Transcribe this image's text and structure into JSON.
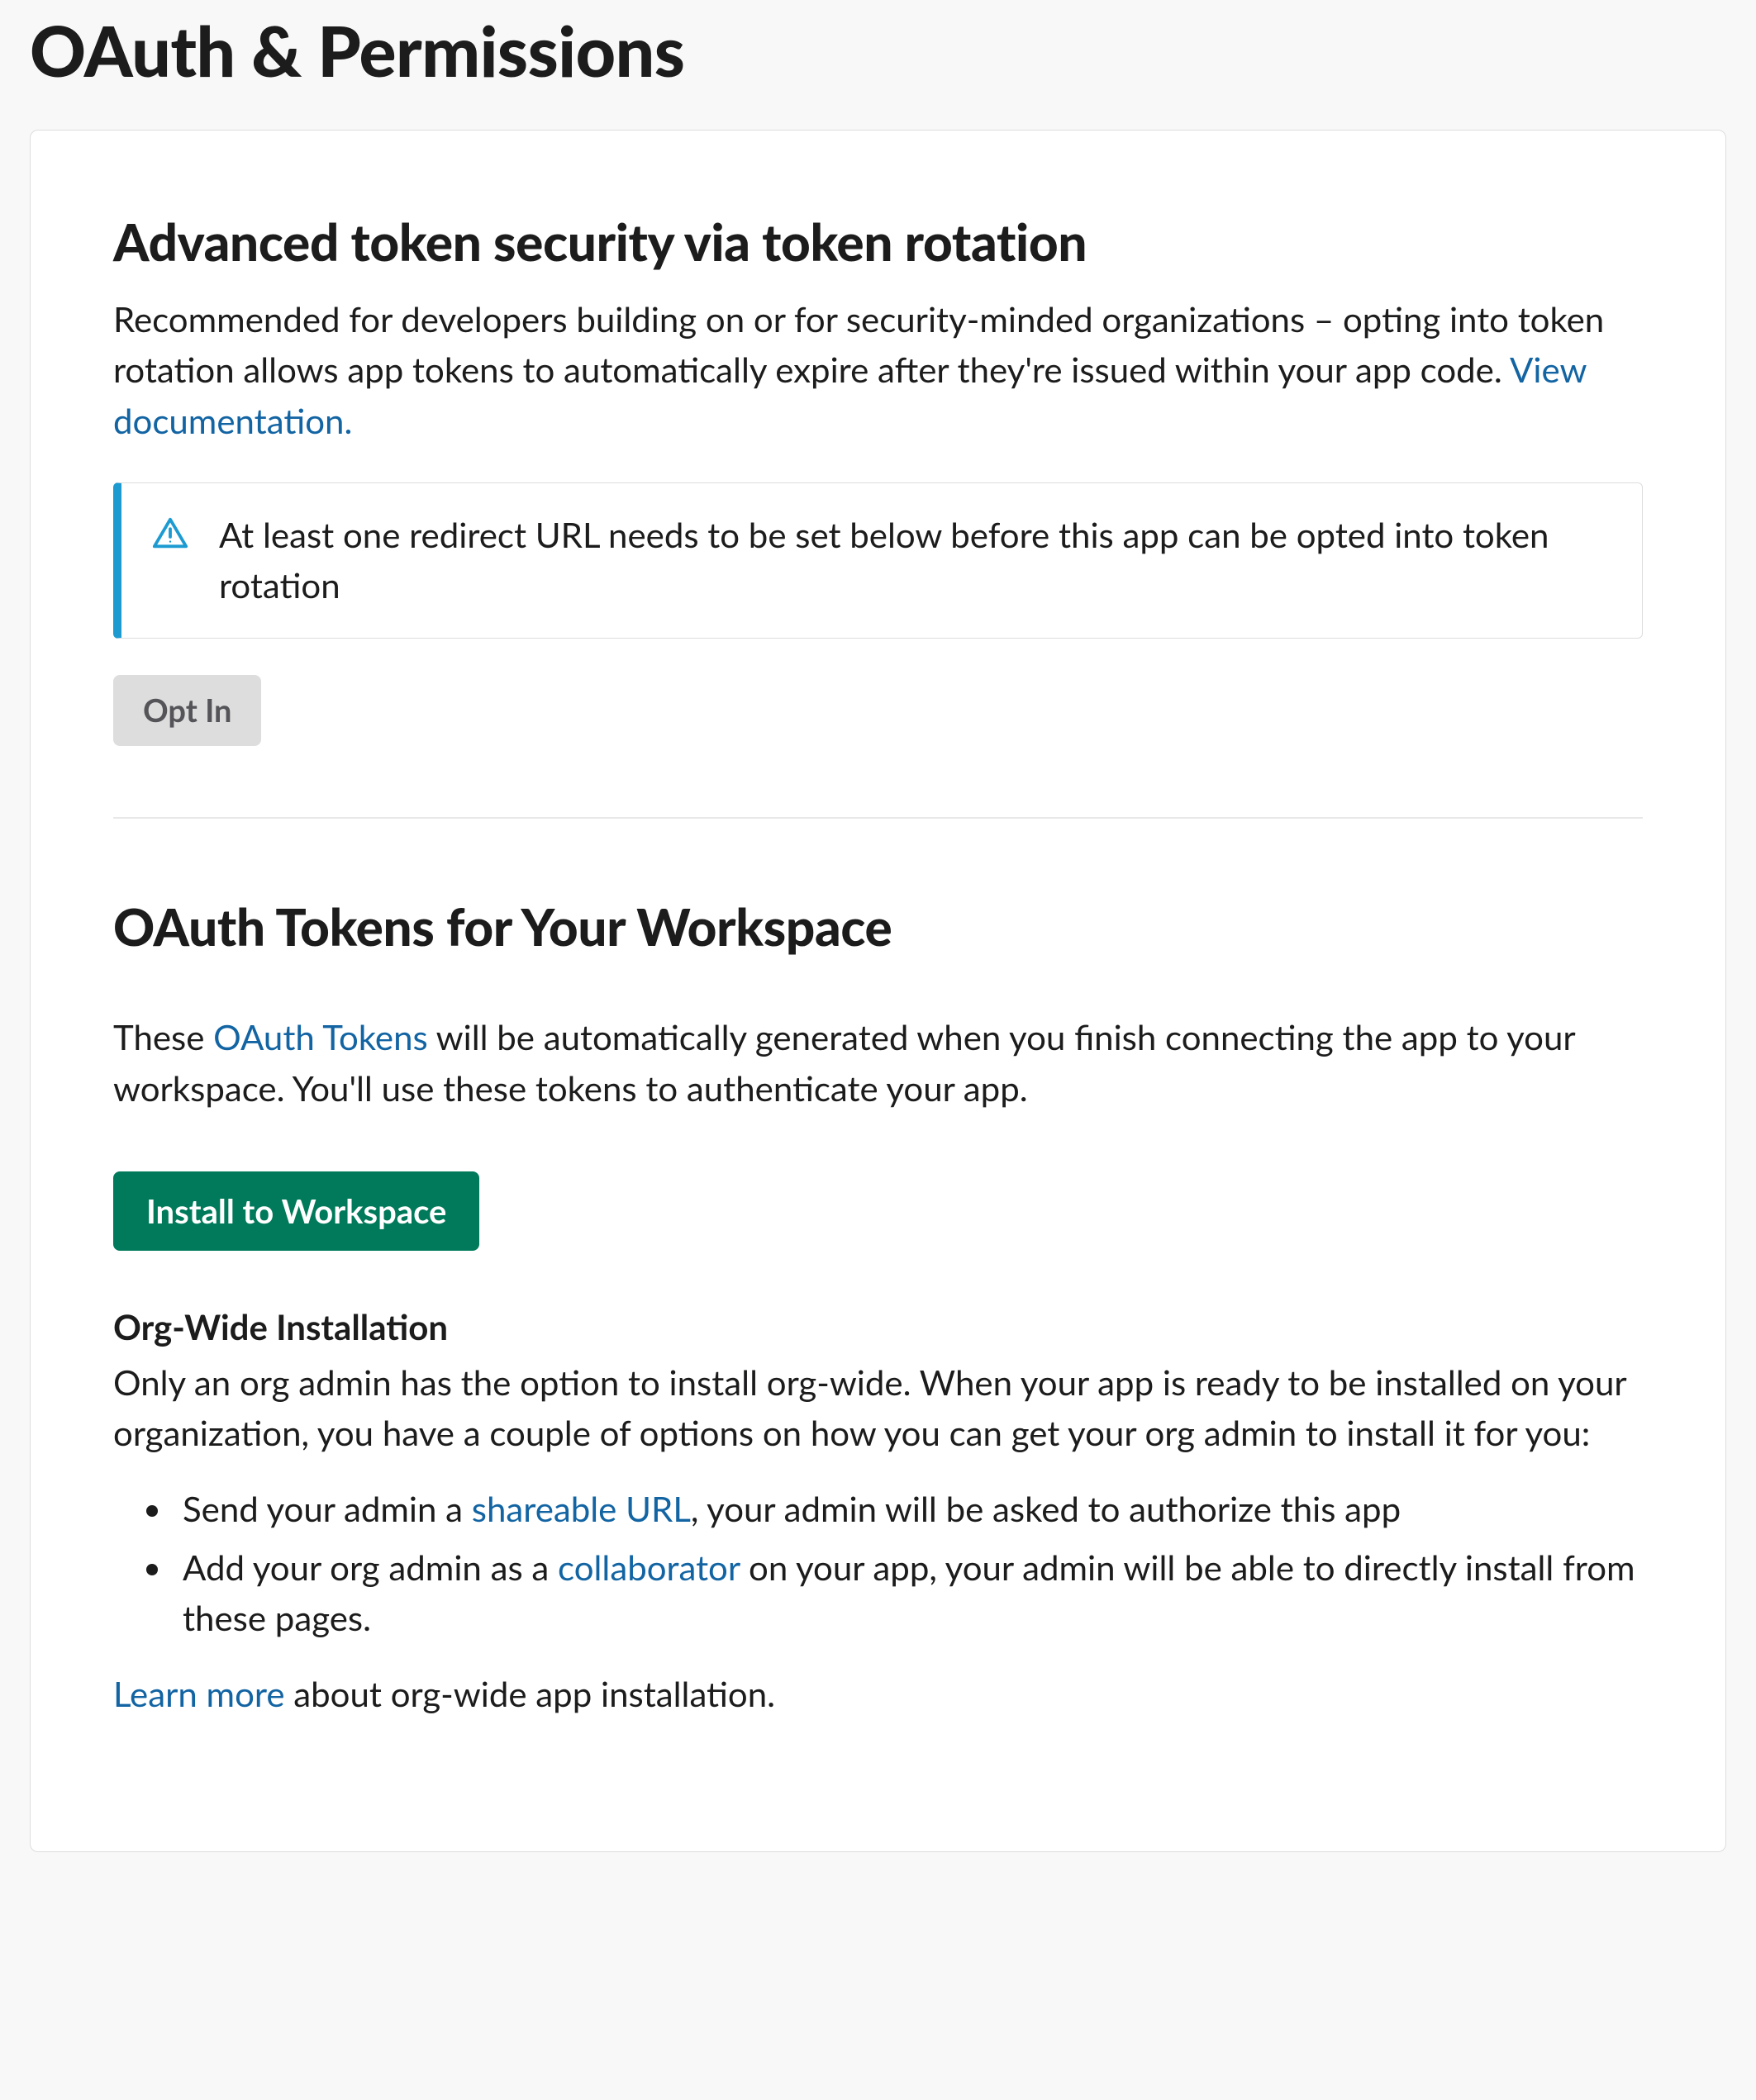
{
  "page": {
    "title": "OAuth & Permissions"
  },
  "section1": {
    "heading": "Advanced token security via token rotation",
    "desc_pre": "Recommended for developers building on or for security-minded organizations – opting into token rotation allows app tokens to automatically expire after they're issued within your app code. ",
    "doc_link": "View documentation.",
    "alert_text": "At least one redirect URL needs to be set below before this app can be opted into token rotation",
    "opt_in_label": "Opt In"
  },
  "section2": {
    "heading": "OAuth Tokens for Your Workspace",
    "desc_pre": "These ",
    "link1": "OAuth Tokens",
    "desc_post": " will be automatically generated when you finish connecting the app to your workspace. You'll use these tokens to authenticate your app.",
    "install_label": "Install to Workspace",
    "orgwide_heading": "Org-Wide Installation",
    "orgwide_desc": "Only an org admin has the option to install org-wide. When your app is ready to be installed on your organization, you have a couple of options on how you can get your org admin to install it for you:",
    "bullet1_pre": "Send your admin a ",
    "bullet1_link": "shareable URL",
    "bullet1_post": ", your admin will be asked to authorize this app",
    "bullet2_pre": "Add your org admin as a ",
    "bullet2_link": "collaborator",
    "bullet2_post": " on your app, your admin will be able to directly install from these pages.",
    "learn_more_link": "Learn more",
    "learn_more_post": " about org-wide app installation."
  },
  "colors": {
    "accent_blue": "#1264a3",
    "alert_blue": "#1d9bd1",
    "primary_green": "#007a5a"
  }
}
